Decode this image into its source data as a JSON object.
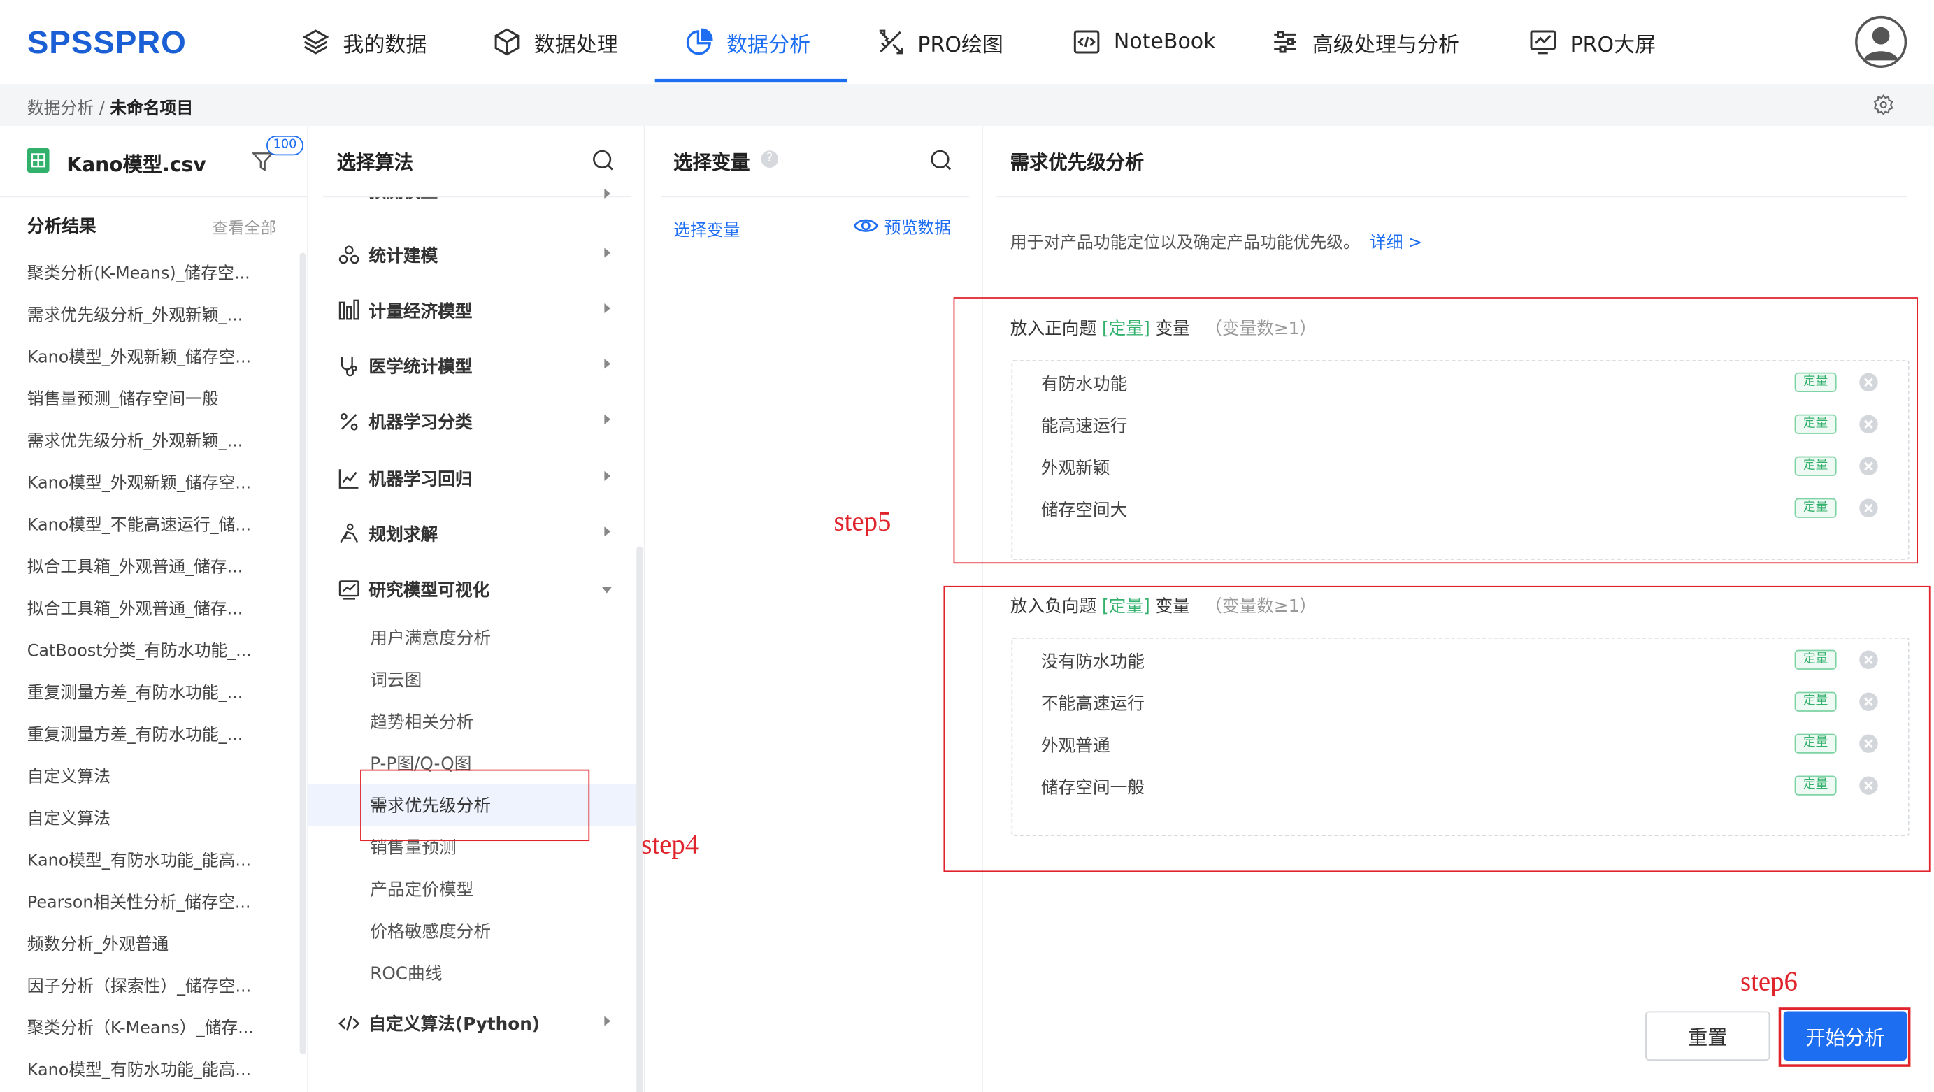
{
  "app": {
    "logo": "SPSSPRO"
  },
  "nav": {
    "items": [
      {
        "label": "我的数据",
        "icon": "layers-icon"
      },
      {
        "label": "数据处理",
        "icon": "cube-icon"
      },
      {
        "label": "数据分析",
        "icon": "pie-chart-icon",
        "active": true
      },
      {
        "label": "PRO绘图",
        "icon": "drawing-tools-icon"
      },
      {
        "label": "NoteBook",
        "icon": "code-icon"
      },
      {
        "label": "高级处理与分析",
        "icon": "sliders-icon"
      },
      {
        "label": "PRO大屏",
        "icon": "monitor-chart-icon"
      }
    ],
    "active_color": "#1e6ef2"
  },
  "breadcrumb": {
    "parent": "数据分析",
    "separator": " / ",
    "current": "未命名项目"
  },
  "left_panel": {
    "file_name": "Kano模型.csv",
    "filter_badge": "100",
    "results_title": "分析结果",
    "view_all": "查看全部",
    "results": [
      "聚类分析(K-Means)_储存空...",
      "需求优先级分析_外观新颖_...",
      "Kano模型_外观新颖_储存空...",
      "销售量预测_储存空间一般",
      "需求优先级分析_外观新颖_...",
      "Kano模型_外观新颖_储存空...",
      "Kano模型_不能高速运行_储...",
      "拟合工具箱_外观普通_储存...",
      "拟合工具箱_外观普通_储存...",
      "CatBoost分类_有防水功能_...",
      "重复测量方差_有防水功能_...",
      "重复测量方差_有防水功能_...",
      "自定义算法",
      "自定义算法",
      "Kano模型_有防水功能_能高...",
      "Pearson相关性分析_储存空...",
      "频数分析_外观普通",
      "因子分析（探索性）_储存空...",
      "聚类分析（K-Means）_储存...",
      "Kano模型_有防水功能_能高..."
    ]
  },
  "algorithm_panel": {
    "title": "选择算法",
    "partial_top_label": "预测模型",
    "categories": [
      {
        "label": "统计建模",
        "icon": "graph-nodes-icon"
      },
      {
        "label": "计量经济模型",
        "icon": "bars-icon"
      },
      {
        "label": "医学统计模型",
        "icon": "stethoscope-icon"
      },
      {
        "label": "机器学习分类",
        "icon": "percent-icon"
      },
      {
        "label": "机器学习回归",
        "icon": "line-chart-icon"
      },
      {
        "label": "规划求解",
        "icon": "person-icon"
      },
      {
        "label": "研究模型可视化",
        "icon": "chart-window-icon",
        "expanded": true
      }
    ],
    "sub_items": [
      "用户满意度分析",
      "词云图",
      "趋势相关分析",
      "P-P图/Q-Q图",
      "需求优先级分析",
      "销售量预测",
      "产品定价模型",
      "价格敏感度分析",
      "ROC曲线"
    ],
    "selected": "需求优先级分析",
    "custom_python": {
      "label": "自定义算法(Python)",
      "icon": "code-brackets-icon"
    }
  },
  "variable_panel": {
    "title": "选择变量",
    "select_link": "选择变量",
    "preview_link": "预览数据"
  },
  "analysis_panel": {
    "title": "需求优先级分析",
    "description": "用于对产品功能定位以及确定产品功能优先级。",
    "detail_link": "详细 >",
    "positive": {
      "label_prefix": "放入正向题",
      "label_type": "[定量]",
      "label_suffix": "变量",
      "hint": "（变量数≥1）",
      "vars": [
        {
          "name": "有防水功能",
          "tag": "定量"
        },
        {
          "name": "能高速运行",
          "tag": "定量"
        },
        {
          "name": "外观新颖",
          "tag": "定量"
        },
        {
          "name": "储存空间大",
          "tag": "定量"
        }
      ]
    },
    "negative": {
      "label_prefix": "放入负向题",
      "label_type": "[定量]",
      "label_suffix": "变量",
      "hint": "（变量数≥1）",
      "vars": [
        {
          "name": "没有防水功能",
          "tag": "定量"
        },
        {
          "name": "不能高速运行",
          "tag": "定量"
        },
        {
          "name": "外观普通",
          "tag": "定量"
        },
        {
          "name": "储存空间一般",
          "tag": "定量"
        }
      ]
    },
    "reset_button": "重置",
    "start_button": "开始分析"
  },
  "annotations": {
    "step4": "step4",
    "step5": "step5",
    "step6": "step6",
    "color": "#e0242c"
  }
}
